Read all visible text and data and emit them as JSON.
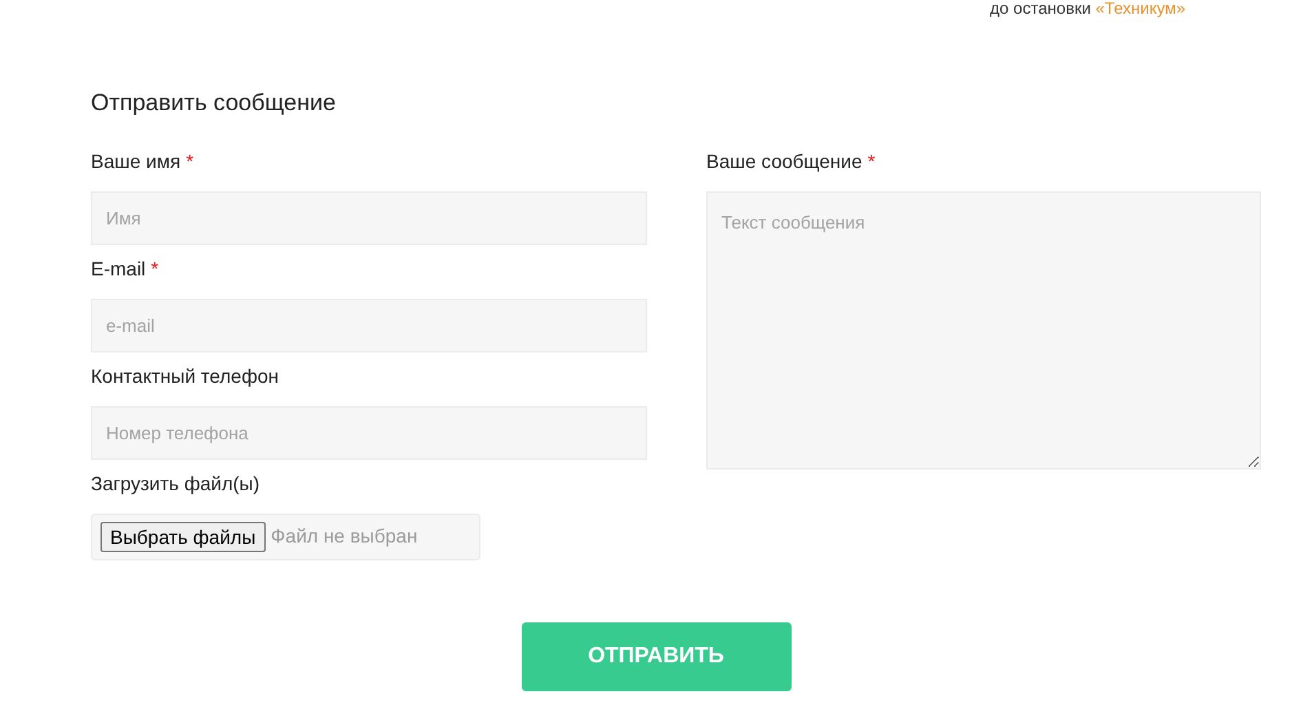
{
  "top_note": {
    "text": "до остановки",
    "link": "«Техникум»"
  },
  "form": {
    "title": "Отправить сообщение",
    "left_fields": [
      {
        "kind": "input",
        "label": "Ваше имя",
        "required": true,
        "placeholder": "Имя"
      },
      {
        "kind": "input",
        "label": "E-mail",
        "required": true,
        "placeholder": "e-mail"
      },
      {
        "kind": "input",
        "label": "Контактный телефон",
        "required": false,
        "placeholder": "Номер телефона"
      },
      {
        "kind": "file",
        "label": "Загрузить файл(ы)",
        "required": false,
        "button": "Выбрать файлы",
        "status": "Файл не выбран"
      }
    ],
    "message_field": {
      "label": "Ваше сообщение",
      "required": true,
      "placeholder": "Текст сообщения"
    },
    "required_mark": "*",
    "submit": "ОТПРАВИТЬ"
  }
}
